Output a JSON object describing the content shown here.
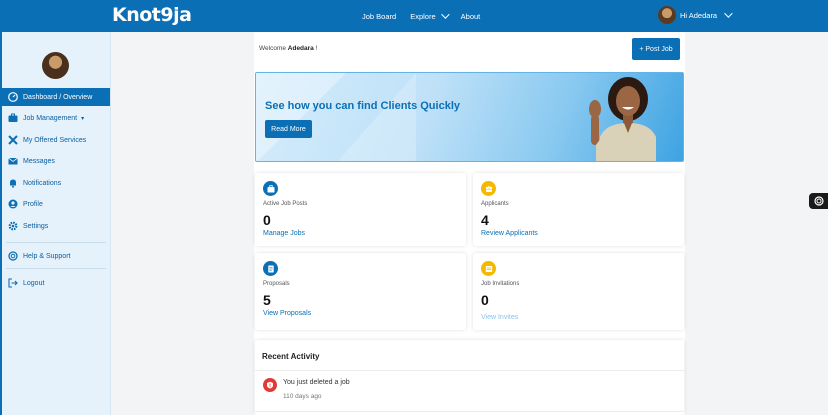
{
  "brand": {
    "logo_text": "Knot9ja",
    "primary_color": "#0b6fb5"
  },
  "topnav": {
    "items": [
      {
        "label": "Job Board"
      },
      {
        "label": "Explore"
      },
      {
        "label": "About"
      }
    ],
    "user_greeting": "Hi Adedara"
  },
  "sidebar": {
    "items": [
      {
        "label": "Dashboard / Overview",
        "icon": "dashboard-icon"
      },
      {
        "label": "Job Management",
        "icon": "briefcase-icon"
      },
      {
        "label": "My Offered Services",
        "icon": "tools-icon"
      },
      {
        "label": "Messages",
        "icon": "envelope-icon"
      },
      {
        "label": "Notifications",
        "icon": "bell-icon"
      },
      {
        "label": "Profile",
        "icon": "user-icon"
      },
      {
        "label": "Settings",
        "icon": "gear-icon"
      },
      {
        "label": "Help & Support",
        "icon": "lifebuoy-icon"
      },
      {
        "label": "Logout",
        "icon": "logout-icon"
      }
    ]
  },
  "header": {
    "welcome_prefix": "Welcome ",
    "welcome_name": "Adedara",
    "welcome_suffix": " !",
    "post_job_label": "+ Post Job"
  },
  "banner": {
    "title": "See how you can find Clients Quickly",
    "button_label": "Read More"
  },
  "stats": [
    {
      "label": "Active Job Posts",
      "value": "0",
      "link": "Manage Jobs",
      "icon": "briefcase-icon",
      "color": "#0b6fb5"
    },
    {
      "label": "Applicants",
      "value": "4",
      "link": "Review Applicants",
      "icon": "group-icon",
      "color": "#f5b800"
    },
    {
      "label": "Proposals",
      "value": "5",
      "link": "View Proposals",
      "icon": "document-icon",
      "color": "#0b6fb5"
    },
    {
      "label": "Job Invitations",
      "value": "0",
      "link": "View Invites",
      "icon": "invitation-icon",
      "color": "#f5b800"
    }
  ],
  "activity": {
    "title": "Recent Activity",
    "items": [
      {
        "text": "You just deleted a job",
        "time": "110 days ago",
        "icon": "alert-icon"
      }
    ]
  }
}
